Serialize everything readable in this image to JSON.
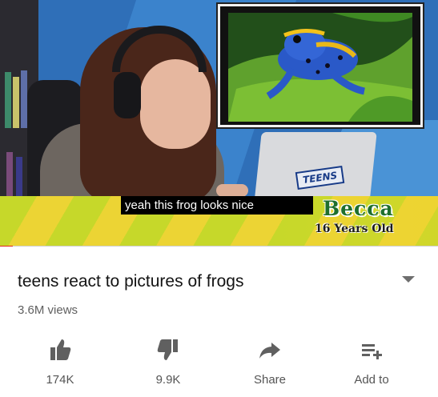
{
  "video": {
    "subtitle": "yeah this frog looks nice",
    "laptop_tag": "TEENS",
    "name": "Becca",
    "age": "16 Years Old",
    "progress": 0.03,
    "accent_color": "#e1261c"
  },
  "info": {
    "title": "teens react to pictures of frogs",
    "views": "3.6M views",
    "expand_icon": "chevron-down-icon"
  },
  "actions": [
    {
      "icon": "thumbs-up-icon",
      "label": "174K"
    },
    {
      "icon": "thumbs-down-icon",
      "label": "9.9K"
    },
    {
      "icon": "share-icon",
      "label": "Share"
    },
    {
      "icon": "add-to-playlist-icon",
      "label": "Add to"
    }
  ]
}
